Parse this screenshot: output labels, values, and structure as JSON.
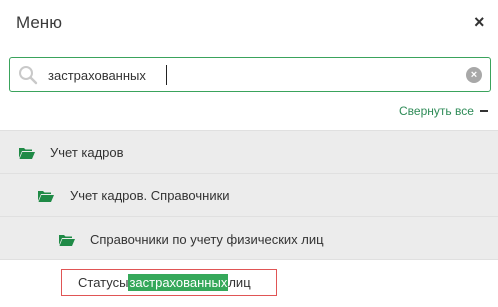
{
  "header": {
    "title": "Меню",
    "close_symbol": "×"
  },
  "search": {
    "value": "застрахованных",
    "clear_symbol": "×"
  },
  "collapse_label": "Свернуть все",
  "tree": [
    {
      "label": "Учет кадров"
    },
    {
      "label": "Учет кадров. Справочники"
    },
    {
      "label": "Справочники по учету физических лиц"
    }
  ],
  "result": {
    "prefix": "Статусы",
    "highlight": "застрахованных",
    "suffix": "лиц"
  },
  "colors": {
    "accent": "#35a85a",
    "folder": "#1f8a46",
    "result_border": "#e05555"
  }
}
